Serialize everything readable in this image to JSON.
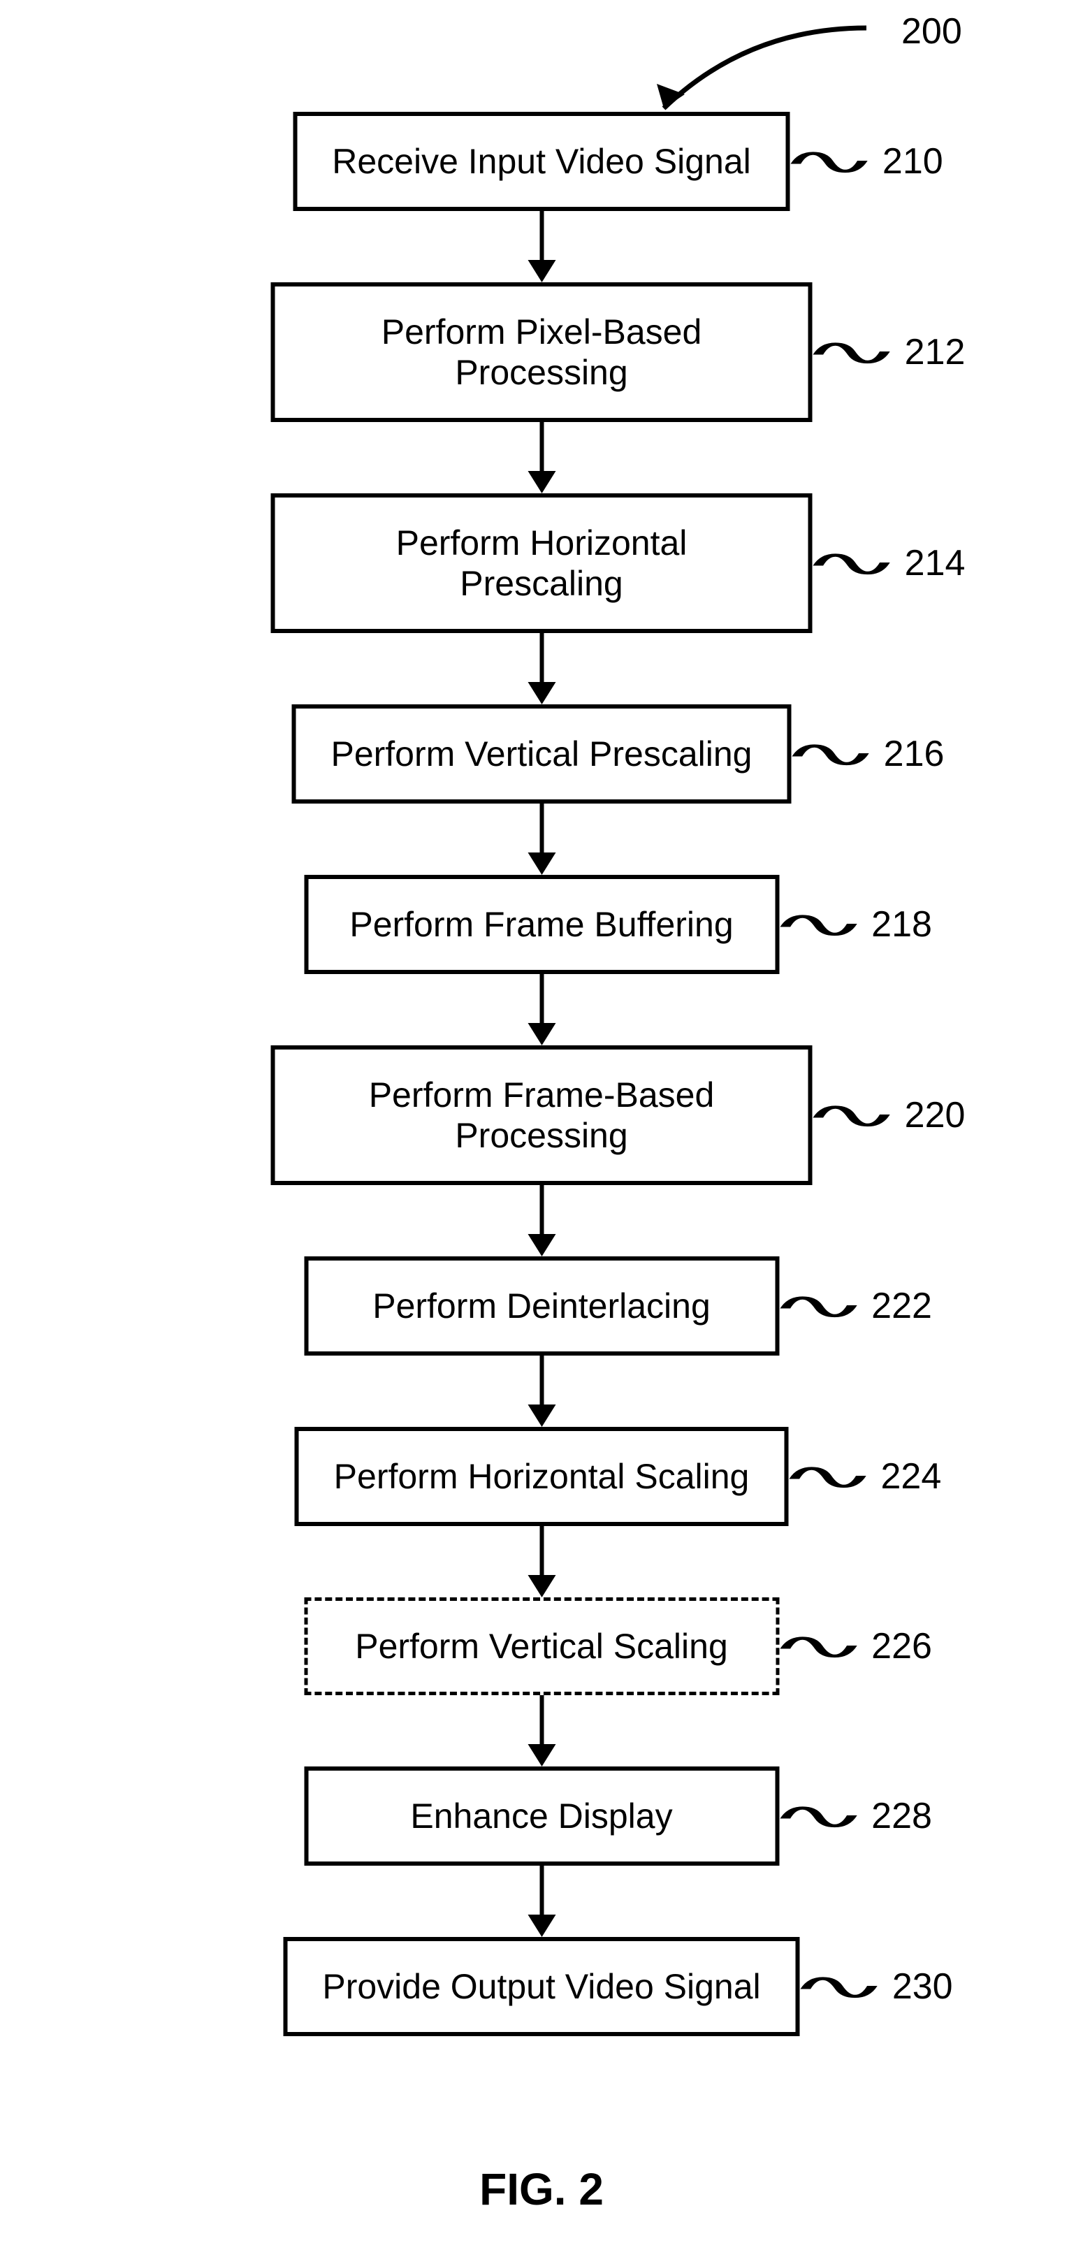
{
  "figure_ref": "200",
  "figure_label": "FIG. 2",
  "steps": [
    {
      "label": "Receive Input Video Signal",
      "ref": "210",
      "dashed": false
    },
    {
      "label": "Perform Pixel-Based Processing",
      "ref": "212",
      "dashed": false
    },
    {
      "label": "Perform Horizontal Prescaling",
      "ref": "214",
      "dashed": false
    },
    {
      "label": "Perform Vertical Prescaling",
      "ref": "216",
      "dashed": false
    },
    {
      "label": "Perform Frame Buffering",
      "ref": "218",
      "dashed": false
    },
    {
      "label": "Perform Frame-Based Processing",
      "ref": "220",
      "dashed": false
    },
    {
      "label": "Perform Deinterlacing",
      "ref": "222",
      "dashed": false
    },
    {
      "label": "Perform Horizontal Scaling",
      "ref": "224",
      "dashed": false
    },
    {
      "label": "Perform Vertical Scaling",
      "ref": "226",
      "dashed": true
    },
    {
      "label": "Enhance Display",
      "ref": "228",
      "dashed": false
    },
    {
      "label": "Provide Output Video Signal",
      "ref": "230",
      "dashed": false
    }
  ]
}
